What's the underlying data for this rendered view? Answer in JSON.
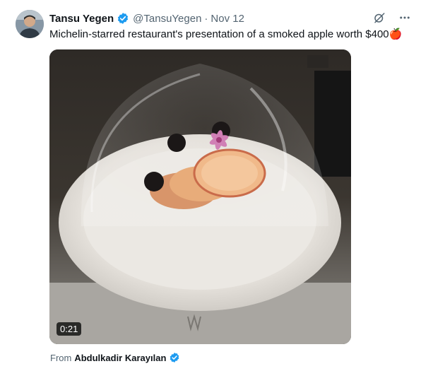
{
  "author": {
    "name": "Tansu Yegen",
    "handle": "@TansuYegen",
    "separator": "·",
    "date": "Nov 12",
    "verified_color": "#1d9bf0"
  },
  "tweet": {
    "text": "Michelin-starred restaurant's presentation of a smoked apple worth $400",
    "emoji": "🍎"
  },
  "media": {
    "duration": "0:21"
  },
  "attribution": {
    "prefix": "From",
    "name": "Abdulkadir Karayılan"
  },
  "icons": {
    "grok": "grok-icon",
    "more": "more-icon",
    "verified": "verified-badge-icon"
  },
  "colors": {
    "text": "#0f1419",
    "secondary": "#536471",
    "accent": "#1d9bf0"
  }
}
